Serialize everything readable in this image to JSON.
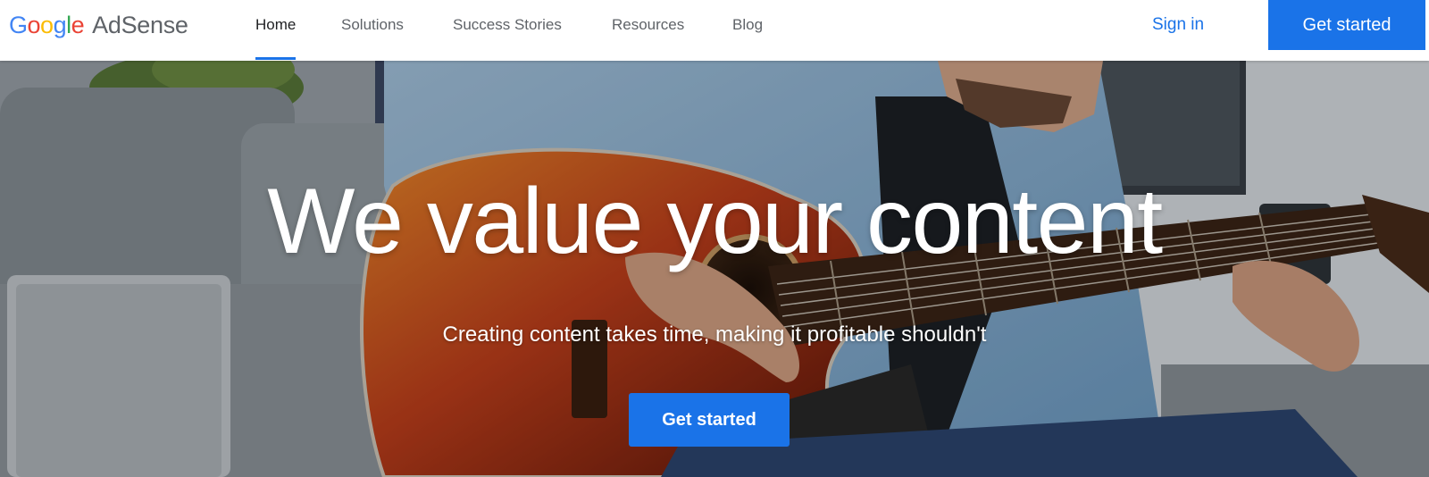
{
  "brand": {
    "google_letters": [
      {
        "char": "G",
        "color": "#4285F4"
      },
      {
        "char": "o",
        "color": "#EA4335"
      },
      {
        "char": "o",
        "color": "#FBBC05"
      },
      {
        "char": "g",
        "color": "#4285F4"
      },
      {
        "char": "l",
        "color": "#34A853"
      },
      {
        "char": "e",
        "color": "#EA4335"
      }
    ],
    "product": "AdSense"
  },
  "nav": {
    "items": [
      {
        "label": "Home",
        "active": true
      },
      {
        "label": "Solutions",
        "active": false
      },
      {
        "label": "Success Stories",
        "active": false
      },
      {
        "label": "Resources",
        "active": false
      },
      {
        "label": "Blog",
        "active": false
      }
    ]
  },
  "header": {
    "sign_in": "Sign in",
    "cta": "Get started"
  },
  "hero": {
    "title": "We value your content",
    "subtitle": "Creating content takes time, making it profitable shouldn't",
    "cta": "Get started",
    "image_description_icon": "man-playing-guitar-photo"
  },
  "colors": {
    "accent": "#1a73e8",
    "nav_text": "#5f6368",
    "nav_active_text": "#202124",
    "hero_text": "#ffffff"
  }
}
